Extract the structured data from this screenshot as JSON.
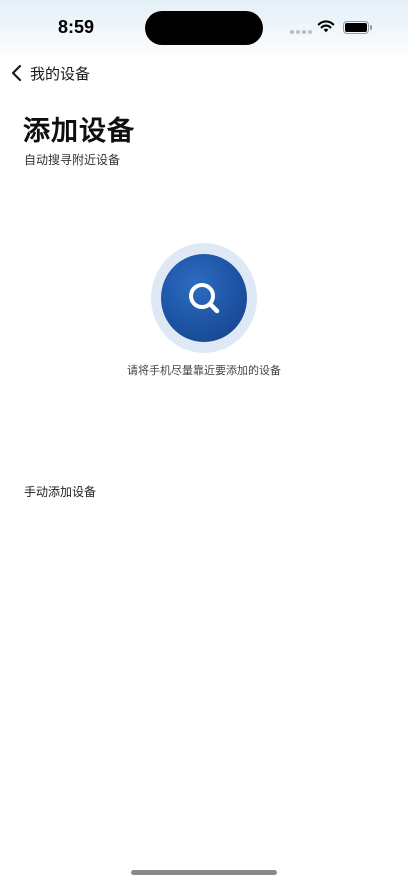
{
  "status_bar": {
    "time": "8:59",
    "wifi_icon": "wifi-icon",
    "battery_icon": "battery-icon"
  },
  "nav": {
    "back_icon": "chevron-left-icon",
    "back_label": "我的设备"
  },
  "header": {
    "title": "添加设备",
    "subtitle": "自动搜寻附近设备"
  },
  "scan": {
    "icon": "search-icon",
    "hint": "请将手机尽量靠近要添加的设备",
    "accent_color": "#1d53a3",
    "halo_color": "#dfe9f6"
  },
  "manual": {
    "label": "手动添加设备"
  }
}
